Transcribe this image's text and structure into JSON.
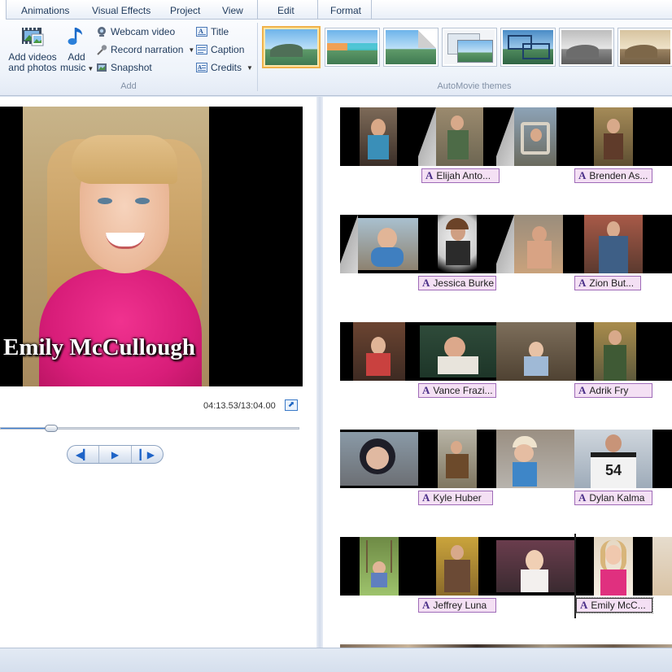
{
  "tabs": [
    "Animations",
    "Visual Effects",
    "Project",
    "View",
    "Edit",
    "Format"
  ],
  "ribbon": {
    "add_group": {
      "label": "Add",
      "add_videos": {
        "line1": "Add videos",
        "line2": "and photos",
        "icon": "film-photo-icon"
      },
      "add_music": {
        "line1": "Add",
        "line2": "music",
        "icon": "music-note-icon"
      },
      "webcam_video": "Webcam video",
      "record_narration": "Record narration",
      "snapshot": "Snapshot",
      "title": "Title",
      "caption": "Caption",
      "credits": "Credits"
    },
    "automovie_group": {
      "label": "AutoMovie themes",
      "themes": [
        "default",
        "contemporary",
        "fade",
        "pan-and-zoom",
        "cinematic",
        "black-and-white",
        "sepia"
      ]
    }
  },
  "preview": {
    "caption": "Emily McCullough",
    "timecode": "04:13.53/13:04.00",
    "seek_fraction": 0.17
  },
  "storyboard": {
    "rows": [
      {
        "titles": [
          "Elijah Anto...",
          "Brenden As..."
        ]
      },
      {
        "titles": [
          "Jessica Burke",
          "Zion But..."
        ]
      },
      {
        "titles": [
          "Vance Frazi...",
          "Adrik Fry"
        ]
      },
      {
        "titles": [
          "Kyle Huber",
          "Dylan Kalma"
        ]
      },
      {
        "titles": [
          "Jeffrey Luna",
          "Emily McC..."
        ]
      }
    ]
  },
  "colors": {
    "selected_theme_border": "#f0b24a",
    "title_chip_bg": "#f4e0f4",
    "accent_blue": "#1f64c7"
  }
}
